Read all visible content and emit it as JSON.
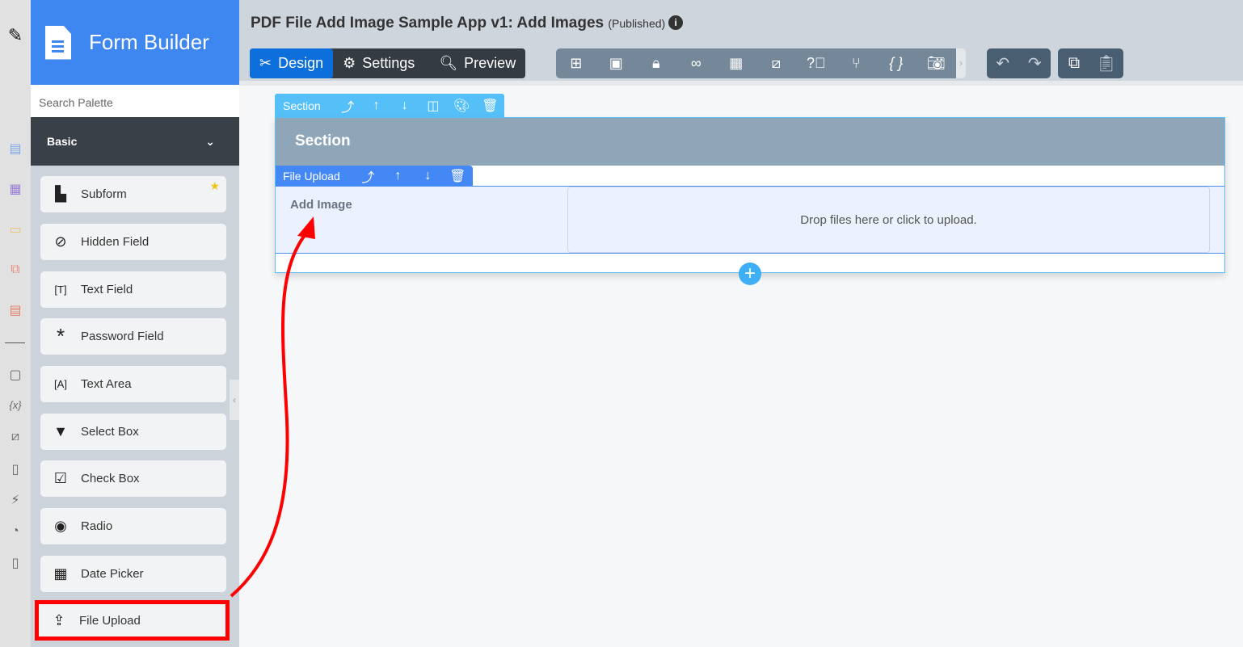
{
  "palette": {
    "title": "Form Builder",
    "search_placeholder": "Search Palette",
    "category": "Basic",
    "items": [
      {
        "label": "Subform"
      },
      {
        "label": "Hidden Field"
      },
      {
        "label": "Text Field"
      },
      {
        "label": "Password Field"
      },
      {
        "label": "Text Area"
      },
      {
        "label": "Select Box"
      },
      {
        "label": "Check Box"
      },
      {
        "label": "Radio"
      },
      {
        "label": "Date Picker"
      },
      {
        "label": "File Upload"
      }
    ]
  },
  "header": {
    "title": "PDF File Add Image Sample App v1: Add Images",
    "status": "(Published)",
    "modes": {
      "design": "Design",
      "settings": "Settings",
      "preview": "Preview"
    }
  },
  "canvas": {
    "section_toolbar_label": "Section",
    "section_title": "Section",
    "field_toolbar_label": "File Upload",
    "field_label": "Add Image",
    "dropzone_text": "Drop files here or click to upload."
  },
  "colors": {
    "brand": "#3e86f0",
    "design_active": "#0d6fdb",
    "section_toolbar": "#55c0f8",
    "field_toolbar": "#4488f5",
    "annotation": "#ff0000"
  }
}
